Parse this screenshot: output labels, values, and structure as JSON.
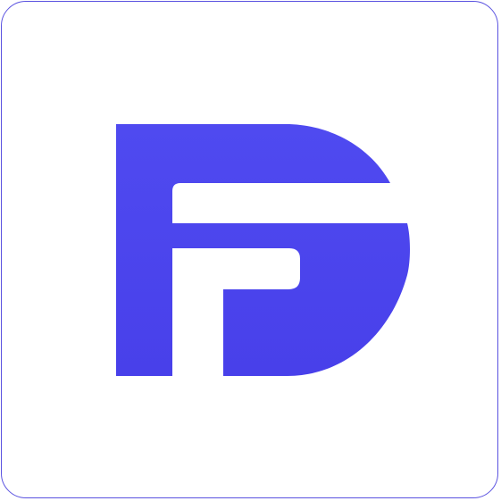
{
  "icon": {
    "semantic": "letter-f-d-logo",
    "colors": {
      "brand": "#4f4af0",
      "brand_dark": "#4840ea",
      "border": "#5a52e0",
      "background": "#ffffff"
    }
  }
}
